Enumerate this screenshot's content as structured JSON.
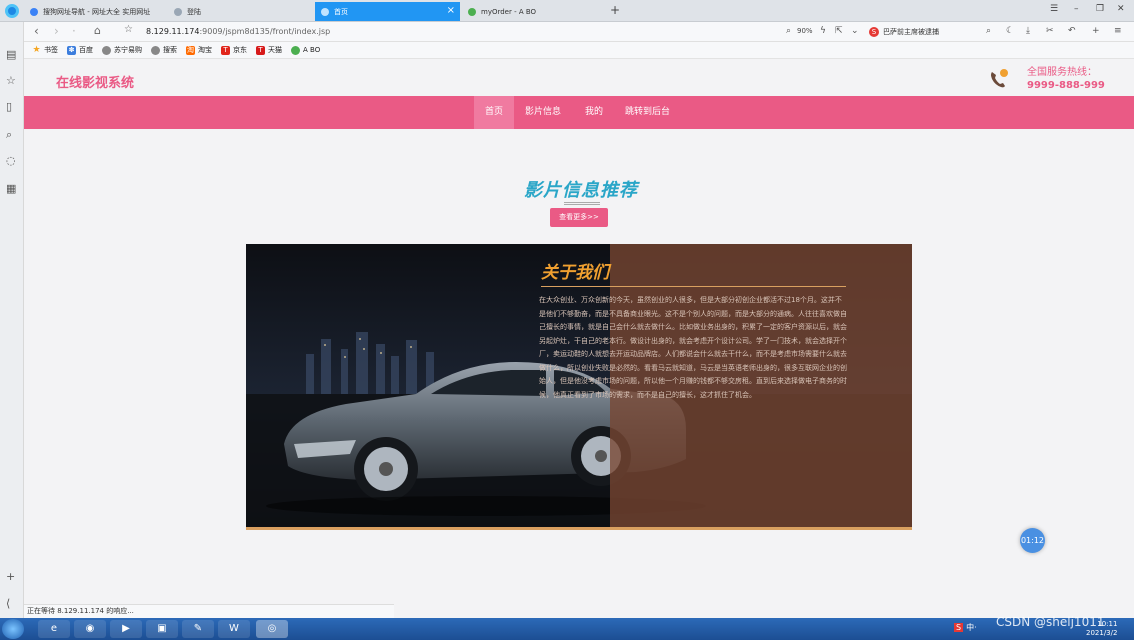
{
  "browser": {
    "tabs": [
      {
        "label": "搜狗网址导航 - 网址大全 实用网址",
        "active": false
      },
      {
        "label": "登陆",
        "active": false
      },
      {
        "label": "首页",
        "active": true
      },
      {
        "label": "myOrder - A BO",
        "active": false
      }
    ],
    "new_tab": "+",
    "url_host": "8.129.11.174",
    "url_path": ":9009/jspm8d135/front/index.jsp",
    "zoom": "90%",
    "search_text": "巴萨前主席被逮捕",
    "bookmarks": [
      "书签",
      "百度",
      "苏宁易购",
      "搜索",
      "淘宝",
      "京东",
      "天猫",
      "A BO"
    ],
    "status_text": "正在等待 8.129.11.174 的响应..."
  },
  "site": {
    "title": "在线影视系统",
    "hotline_label": "全国服务热线：",
    "hotline_number": "9999-888-999",
    "nav": [
      "首页",
      "影片信息",
      "我的",
      "跳转到后台"
    ],
    "section_title": "影片信息推荐",
    "more_button": "查看更多>>",
    "about_title": "关于我们",
    "about_text": "在大众创业、万众创新的今天，虽然创业的人很多，但是大部分初创企业都活不过18个月。这并不是他们不够勤奋，而是不具备商业眼光。这不是个别人的问题，而是大部分的通病。人往往喜欢做自己擅长的事情，就是自己会什么就去做什么。比如做业务出身的，积累了一定的客户资源以后，就会另起炉灶，干自己的老本行。做设计出身的，就会考虑开个设计公司。学了一门技术，就会选择开个厂，卖运动鞋的人就想去开运动品牌店。人们都说会什么就去干什么，而不是考虑市场需要什么就去做什么，所以创业失败是必然的。看看马云就知道，马云是当英语老师出身的，很多互联网企业的创始人，但是他没考虑市场的问题，所以他一个月赚的钱都不够交房租。直到后来选择做电子商务的时候，他真正看到了市场的需求，而不是自己的擅长，这才抓住了机会。",
    "chat_time": "01:12"
  },
  "taskbar": {
    "tray_text": "中·",
    "clock_time": "10:11",
    "clock_date": "2021/3/2",
    "watermark": "CSDN @shelj1011"
  }
}
